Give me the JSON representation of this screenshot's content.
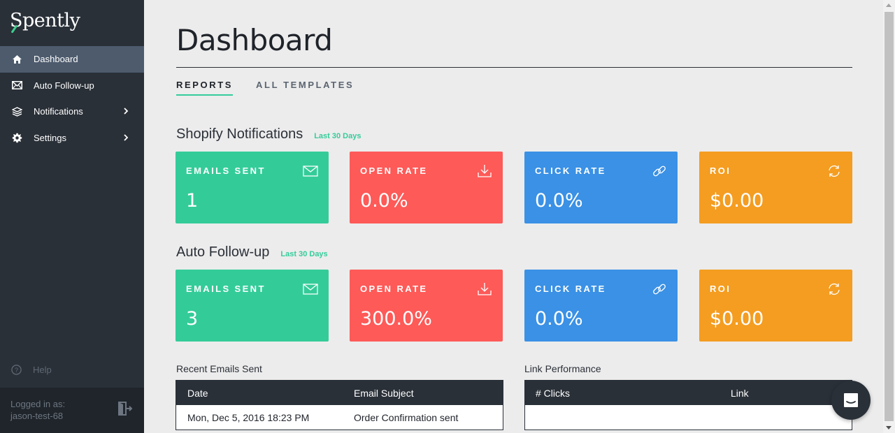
{
  "app": {
    "name": "Spently"
  },
  "sidebar": {
    "items": [
      {
        "label": "Dashboard",
        "icon": "home-icon",
        "active": true
      },
      {
        "label": "Auto Follow-up",
        "icon": "envelope-icon"
      },
      {
        "label": "Notifications",
        "icon": "layers-icon",
        "has_children": true
      },
      {
        "label": "Settings",
        "icon": "gear-icon",
        "has_children": true
      }
    ],
    "help_label": "Help",
    "logged_in_label": "Logged in as:",
    "username": "jason-test-68"
  },
  "main": {
    "title": "Dashboard",
    "tabs": [
      {
        "label": "REPORTS",
        "active": true
      },
      {
        "label": "ALL TEMPLATES",
        "active": false
      }
    ],
    "sections": [
      {
        "title": "Shopify Notifications",
        "range": "Last 30 Days",
        "cards": [
          {
            "label": "EMAILS SENT",
            "value": "1",
            "icon": "envelope-icon",
            "color": "#33cc99"
          },
          {
            "label": "OPEN RATE",
            "value": "0.0%",
            "icon": "download-icon",
            "color": "#fd5a58"
          },
          {
            "label": "CLICK RATE",
            "value": "0.0%",
            "icon": "link-icon",
            "color": "#3a91e5"
          },
          {
            "label": "ROI",
            "value": "$0.00",
            "icon": "refresh-icon",
            "color": "#f49d21"
          }
        ]
      },
      {
        "title": "Auto Follow-up",
        "range": "Last 30 Days",
        "cards": [
          {
            "label": "EMAILS SENT",
            "value": "3",
            "icon": "envelope-icon",
            "color": "#33cc99"
          },
          {
            "label": "OPEN RATE",
            "value": "300.0%",
            "icon": "download-icon",
            "color": "#fd5a58"
          },
          {
            "label": "CLICK RATE",
            "value": "0.0%",
            "icon": "link-icon",
            "color": "#3a91e5"
          },
          {
            "label": "ROI",
            "value": "$0.00",
            "icon": "refresh-icon",
            "color": "#f49d21"
          }
        ]
      }
    ],
    "recent_emails": {
      "title": "Recent Emails Sent",
      "columns": [
        "Date",
        "Email Subject"
      ],
      "rows": [
        [
          "Mon, Dec 5, 2016 18:23 PM",
          "Order Confirmation sent"
        ]
      ]
    },
    "link_performance": {
      "title": "Link Performance",
      "columns": [
        "# Clicks",
        "Link"
      ]
    }
  }
}
